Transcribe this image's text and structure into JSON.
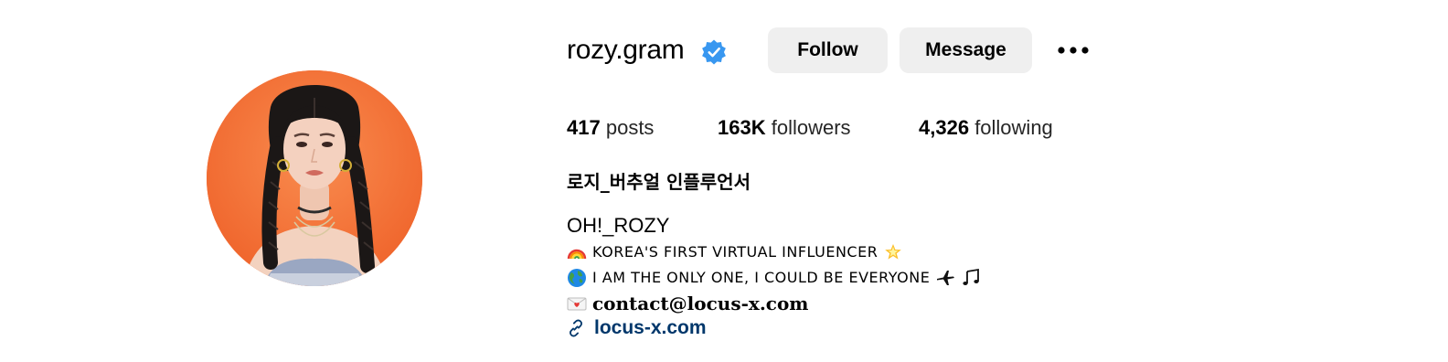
{
  "profile": {
    "username": "rozy.gram",
    "verified": true,
    "follow_label": "Follow",
    "message_label": "Message",
    "stats": {
      "posts_count": "417",
      "posts_label": "posts",
      "followers_count": "163K",
      "followers_label": "followers",
      "following_count": "4,326",
      "following_label": "following"
    },
    "full_name": "로지_버추얼 인플루언서",
    "bio": {
      "title": "OH!_ROZY",
      "line1": "KOREA'S FIRST VIRTUAL INFLUENCER",
      "line2": "I AM THE ONLY ONE, I COULD BE EVERYONE",
      "contact": "contact@locus-x.com",
      "link": "locus-x.com"
    }
  },
  "icons": {
    "verified": "verified-badge-icon",
    "more": "more-options-icon",
    "rainbow": "rainbow-icon",
    "star": "glowing-star-icon",
    "globe": "globe-icon",
    "airplane": "airplane-icon",
    "music": "music-notes-icon",
    "envelope": "love-letter-icon",
    "link": "link-icon"
  },
  "colors": {
    "verified_blue": "#3897f0",
    "button_bg": "#efefef",
    "link_blue": "#00376b",
    "avatar_bg": "#f2713a"
  }
}
